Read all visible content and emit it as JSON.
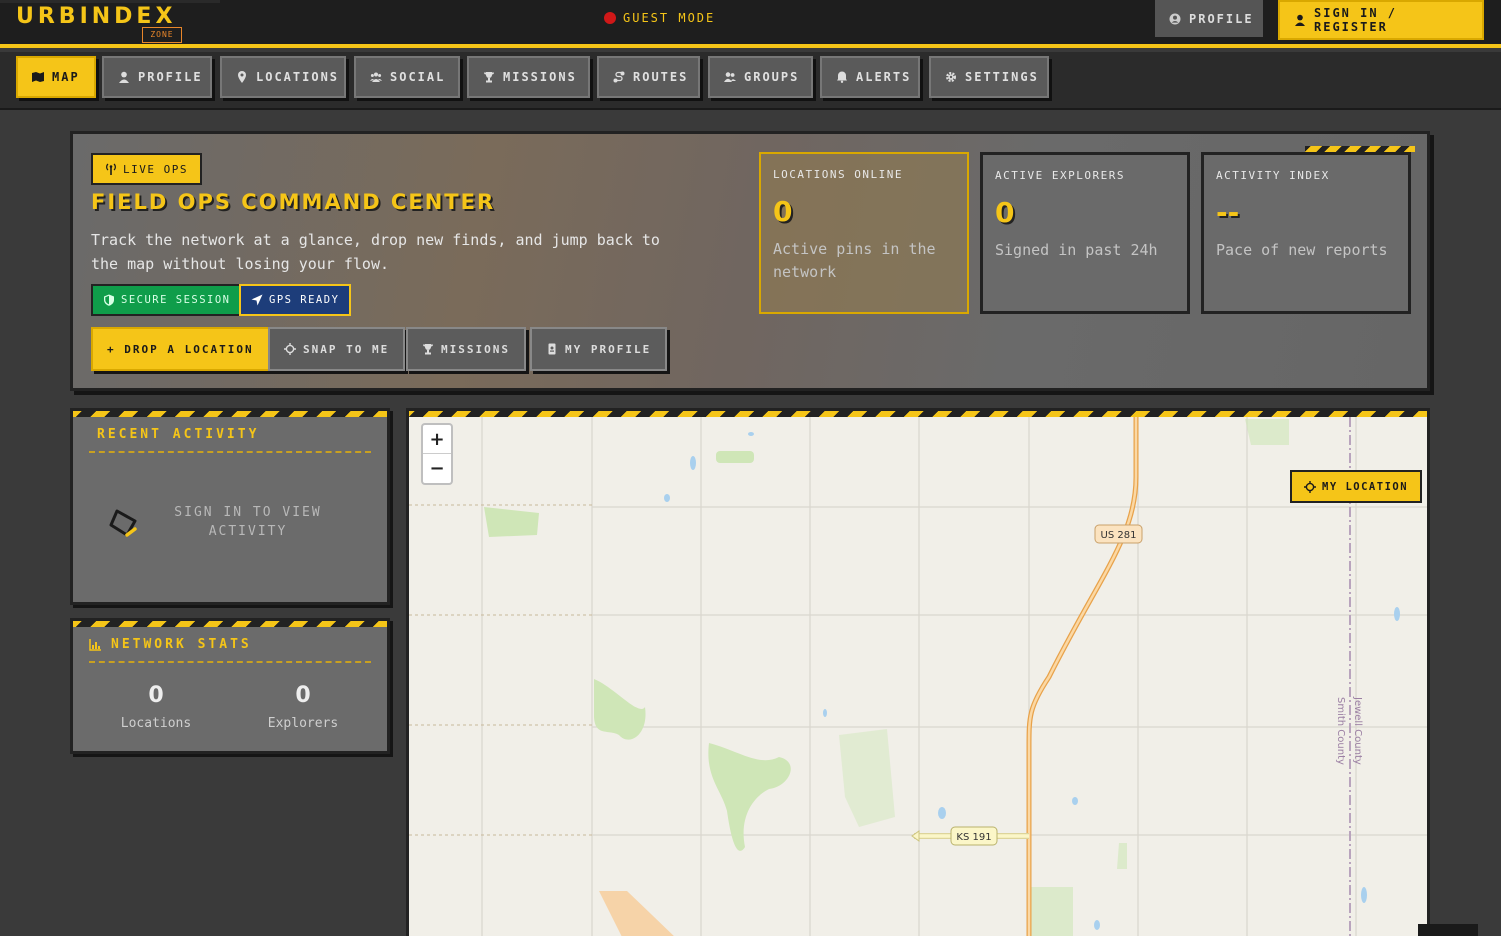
{
  "header": {
    "logo": "URBINDEX",
    "logo_tag": "ZONE",
    "mode_label": "GUEST MODE",
    "profile_label": "PROFILE",
    "signin_label": "SIGN IN / REGISTER"
  },
  "nav": {
    "items": [
      {
        "label": "MAP",
        "icon": "map-icon",
        "active": true
      },
      {
        "label": "PROFILE",
        "icon": "user-icon"
      },
      {
        "label": "LOCATIONS",
        "icon": "pin-icon"
      },
      {
        "label": "SOCIAL",
        "icon": "users-icon"
      },
      {
        "label": "MISSIONS",
        "icon": "trophy-icon"
      },
      {
        "label": "ROUTES",
        "icon": "route-icon"
      },
      {
        "label": "GROUPS",
        "icon": "group-icon"
      },
      {
        "label": "ALERTS",
        "icon": "bell-icon"
      },
      {
        "label": "SETTINGS",
        "icon": "gear-icon"
      }
    ]
  },
  "hero": {
    "badge": "LIVE OPS",
    "title": "FIELD OPS COMMAND CENTER",
    "description": "Track the network at a glance, drop new finds, and jump back to the map without losing your flow.",
    "pills": {
      "secure": "SECURE SESSION",
      "gps": "GPS READY"
    },
    "actions": {
      "drop": "+ DROP A LOCATION",
      "snap": "SNAP TO ME",
      "missions": "MISSIONS",
      "profile": "MY PROFILE"
    },
    "stats": [
      {
        "label": "LOCATIONS ONLINE",
        "value": "0",
        "sub": "Active pins in the network"
      },
      {
        "label": "ACTIVE EXPLORERS",
        "value": "0",
        "sub": "Signed in past 24h"
      },
      {
        "label": "ACTIVITY INDEX",
        "value": "--",
        "sub": "Pace of new reports"
      }
    ]
  },
  "activity": {
    "title": "RECENT ACTIVITY",
    "empty_message": "SIGN IN TO VIEW ACTIVITY"
  },
  "network_stats": {
    "title": "NETWORK STATS",
    "locations_value": "0",
    "locations_label": "Locations",
    "explorers_value": "0",
    "explorers_label": "Explorers"
  },
  "map": {
    "zoom_in": "+",
    "zoom_out": "−",
    "my_location": "MY LOCATION",
    "labels": {
      "us281": "US 281",
      "ks191": "KS 191",
      "smith": "Smith County",
      "jewell": "Jewell County"
    }
  },
  "colors": {
    "accent": "#f5c518",
    "secure": "#0f9d4a",
    "gps": "#1d3d7a",
    "alert_dot": "#d01818"
  }
}
